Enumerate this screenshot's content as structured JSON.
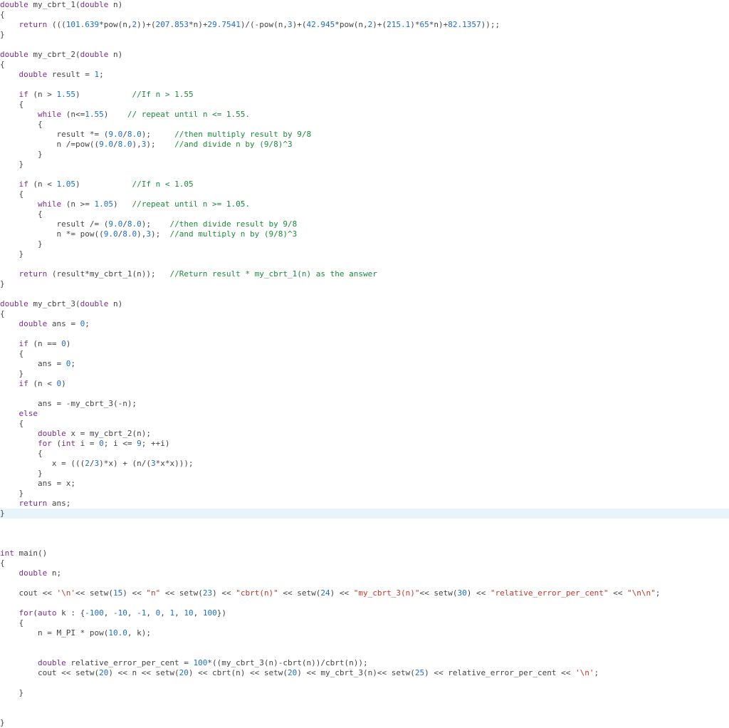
{
  "code": {
    "fn1_sig_kw1": "double",
    "fn1_sig_name": " my_cbrt_1(",
    "fn1_sig_kw2": "double",
    "fn1_sig_tail": " n)",
    "fn1_ret_kw": "return",
    "fn1_ret_a": " (((",
    "fn1_ret_n1": "101.639",
    "fn1_ret_b": "*pow(n,",
    "fn1_ret_n2": "2",
    "fn1_ret_c": "))+(",
    "fn1_ret_n3": "207.853",
    "fn1_ret_d": "*n)+",
    "fn1_ret_n4": "29.7541",
    "fn1_ret_e": ")/(-pow(n,",
    "fn1_ret_n5": "3",
    "fn1_ret_f": ")+(",
    "fn1_ret_n6": "42.945",
    "fn1_ret_g": "*pow(n,",
    "fn1_ret_n7": "2",
    "fn1_ret_h": ")+(",
    "fn1_ret_n8": "215.1",
    "fn1_ret_i": ")*",
    "fn1_ret_n9": "65",
    "fn1_ret_j": "*n)+",
    "fn1_ret_n10": "82.1357",
    "fn1_ret_k": "));;",
    "fn2_sig_kw1": "double",
    "fn2_sig_name": " my_cbrt_2(",
    "fn2_sig_kw2": "double",
    "fn2_sig_tail": " n)",
    "fn2_decl_kw": "double",
    "fn2_decl_rest": " result = ",
    "fn2_decl_n": "1",
    "fn2_if1_kw": "if",
    "fn2_if1_a": " (n > ",
    "fn2_if1_n": "1.55",
    "fn2_if1_b": ")",
    "fn2_if1_cmt": "//If n > 1.55",
    "fn2_w1_kw": "while",
    "fn2_w1_a": " (n<=",
    "fn2_w1_n": "1.55",
    "fn2_w1_b": ")",
    "fn2_w1_cmt": "// repeat until n <= 1.55.",
    "fn2_w1_l1a": "result *= (",
    "fn2_w1_l1n1": "9.0",
    "fn2_w1_l1b": "/",
    "fn2_w1_l1n2": "8.0",
    "fn2_w1_l1c": ");",
    "fn2_w1_l1cmt": "//then multiply result by 9/8",
    "fn2_w1_l2a": "n /=pow((",
    "fn2_w1_l2n1": "9.0",
    "fn2_w1_l2b": "/",
    "fn2_w1_l2n2": "8.0",
    "fn2_w1_l2c": "),",
    "fn2_w1_l2n3": "3",
    "fn2_w1_l2d": ");",
    "fn2_w1_l2cmt": "//and divide n by (9/8)^3",
    "fn2_if2_kw": "if",
    "fn2_if2_a": " (n < ",
    "fn2_if2_n": "1.05",
    "fn2_if2_b": ")",
    "fn2_if2_cmt": "//If n < 1.05",
    "fn2_w2_kw": "while",
    "fn2_w2_a": " (n >= ",
    "fn2_w2_n": "1.05",
    "fn2_w2_b": ")",
    "fn2_w2_cmt": "//repeat until n >= 1.05.",
    "fn2_w2_l1a": "result /= (",
    "fn2_w2_l1n1": "9.0",
    "fn2_w2_l1b": "/",
    "fn2_w2_l1n2": "8.0",
    "fn2_w2_l1c": ");",
    "fn2_w2_l1cmt": "//then divide result by 9/8",
    "fn2_w2_l2a": "n *= pow((",
    "fn2_w2_l2n1": "9.0",
    "fn2_w2_l2b": "/",
    "fn2_w2_l2n2": "8.0",
    "fn2_w2_l2c": "),",
    "fn2_w2_l2n3": "3",
    "fn2_w2_l2d": ");",
    "fn2_w2_l2cmt": "//and multiply n by (9/8)^3",
    "fn2_ret_kw": "return",
    "fn2_ret_a": " (result*my_cbrt_1(n));",
    "fn2_ret_cmt": "//Return result * my_cbrt_1(n) as the answer",
    "fn3_sig_kw1": "double",
    "fn3_sig_name": " my_cbrt_3(",
    "fn3_sig_kw2": "double",
    "fn3_sig_tail": " n)",
    "fn3_decl_kw": "double",
    "fn3_decl_rest": " ans = ",
    "fn3_decl_n": "0",
    "fn3_if0_kw": "if",
    "fn3_if0_a": " (n == ",
    "fn3_if0_n": "0",
    "fn3_if0_b": ")",
    "fn3_if0_body": "ans = ",
    "fn3_if0_body_n": "0",
    "fn3_ifneg_kw": "if",
    "fn3_ifneg_a": " (n < ",
    "fn3_ifneg_n": "0",
    "fn3_ifneg_b": ")",
    "fn3_ifneg_body": "ans = -my_cbrt_3(-n);",
    "fn3_else_kw": "else",
    "fn3_x_kw": "double",
    "fn3_x_rest": " x = my_cbrt_2(n);",
    "fn3_for_kw": "for",
    "fn3_for_a": " (",
    "fn3_for_kw2": "int",
    "fn3_for_b": " i = ",
    "fn3_for_n1": "0",
    "fn3_for_c": "; i <= ",
    "fn3_for_n2": "9",
    "fn3_for_d": "; ++i)",
    "fn3_loop_a": "x = (((",
    "fn3_loop_n1": "2",
    "fn3_loop_b": "/",
    "fn3_loop_n2": "3",
    "fn3_loop_c": ")*x) + (n/(",
    "fn3_loop_n3": "3",
    "fn3_loop_d": "*x*x)));",
    "fn3_ansx": "ans = x;",
    "fn3_ret_kw": "return",
    "fn3_ret_rest": " ans;",
    "main_sig_kw": "int",
    "main_sig_rest": " main()",
    "main_decl_kw": "double",
    "main_decl_rest": " n;",
    "main_cout1_a": "cout << ",
    "main_cout1_s1": "'\\n'",
    "main_cout1_b": "<< setw(",
    "main_cout1_n1": "15",
    "main_cout1_c": ") << ",
    "main_cout1_s2": "\"n\"",
    "main_cout1_d": " << setw(",
    "main_cout1_n2": "23",
    "main_cout1_e": ") << ",
    "main_cout1_s3": "\"cbrt(n)\"",
    "main_cout1_f": " << setw(",
    "main_cout1_n3": "24",
    "main_cout1_g": ") << ",
    "main_cout1_s4": "\"my_cbrt_3(n)\"",
    "main_cout1_h": "<< setw(",
    "main_cout1_n4": "30",
    "main_cout1_i": ") << ",
    "main_cout1_s5": "\"relative_error_per_cent\"",
    "main_cout1_j": " << ",
    "main_cout1_s6": "\"\\n\\n\"",
    "main_cout1_k": ";",
    "main_for_kw": "for",
    "main_for_a": "(",
    "main_for_kw2": "auto",
    "main_for_b": " k : {",
    "main_for_n1": "-100",
    "main_for_c": ", ",
    "main_for_n2": "-10",
    "main_for_n3": "-1",
    "main_for_n4": "0",
    "main_for_n5": "1",
    "main_for_n6": "10",
    "main_for_n7": "100",
    "main_for_d": "})",
    "main_np_a": "n = M_PI * pow(",
    "main_np_n1": "10.0",
    "main_np_b": ", k);",
    "main_rel_kw": "double",
    "main_rel_a": " relative_error_per_cent = ",
    "main_rel_n1": "100",
    "main_rel_b": "*((my_cbrt_3(n)-cbrt(n))/cbrt(n));",
    "main_cout2_a": "cout << setw(",
    "main_cout2_n1": "20",
    "main_cout2_b": ") << n << setw(",
    "main_cout2_n2": "20",
    "main_cout2_c": ") << cbrt(n) << setw(",
    "main_cout2_n3": "20",
    "main_cout2_d": ") << my_cbrt_3(n)<< setw(",
    "main_cout2_n4": "25",
    "main_cout2_e": ") << relative_error_per_cent << ",
    "main_cout2_s1": "'\\n'",
    "main_cout2_f": ";"
  }
}
